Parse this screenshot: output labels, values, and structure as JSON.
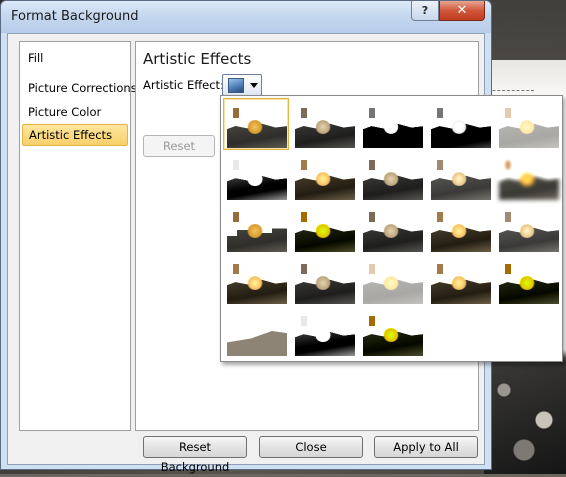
{
  "window": {
    "title": "Format Background",
    "help_label": "?",
    "close_label": "✕"
  },
  "nav": {
    "items": [
      {
        "label": "Fill",
        "selected": false
      },
      {
        "label": "Picture Corrections",
        "selected": false
      },
      {
        "label": "Picture Color",
        "selected": false
      },
      {
        "label": "Artistic Effects",
        "selected": true
      }
    ]
  },
  "panel": {
    "heading": "Artistic Effects",
    "effect_label": "Artistic Effect:",
    "reset_label": "Reset"
  },
  "buttons": {
    "reset_background": "Reset Background",
    "close": "Close",
    "apply_to_all": "Apply to All"
  },
  "gallery": {
    "rows": 5,
    "columns": 5,
    "count": 23,
    "selected_index": 0
  },
  "colors": {
    "selection": "#f9cf6a",
    "titlebar": "#c3d6ee",
    "close_button": "#c03b20"
  }
}
